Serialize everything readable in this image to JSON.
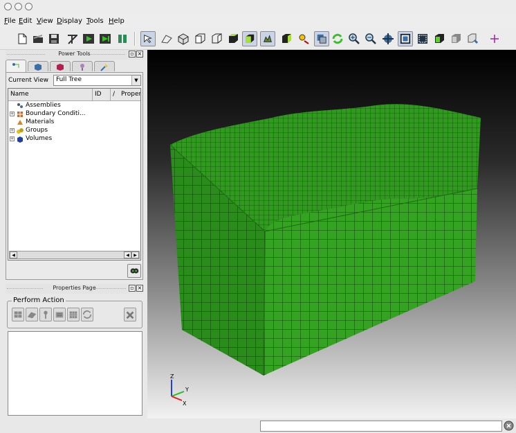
{
  "window": {
    "title": ""
  },
  "menu": {
    "items": [
      {
        "label": "File",
        "underline": "F",
        "rest": "ile"
      },
      {
        "label": "Edit",
        "underline": "E",
        "rest": "dit"
      },
      {
        "label": "View",
        "underline": "V",
        "rest": "iew"
      },
      {
        "label": "Display",
        "underline": "D",
        "rest": "isplay"
      },
      {
        "label": "Tools",
        "underline": "T",
        "rest": "ools"
      },
      {
        "label": "Help",
        "underline": "H",
        "rest": "elp"
      }
    ]
  },
  "toolbar": {
    "icons": [
      "new-file-icon",
      "open-file-icon",
      "save-icon",
      "cut-icon",
      "play-script-icon",
      "record-icon",
      "pause-icon",
      "select-pointer-icon",
      "probe-icon",
      "view-iso-icon",
      "view-front-icon",
      "view-side-icon",
      "view-top-icon",
      "view-bottom-icon",
      "fit-view-icon",
      "perspective-icon",
      "lights-icon",
      "clipping-icon",
      "rotate-icon",
      "zoom-in-icon",
      "zoom-out-icon",
      "pan-icon",
      "wireframe-icon",
      "hidden-line-icon",
      "smooth-shade-icon",
      "transparent-icon",
      "cube-icon",
      "axis-icon"
    ]
  },
  "power_tools": {
    "title": "Power Tools",
    "float_button": "▫",
    "close_button": "×",
    "tabs": [
      "geometry-tab",
      "mesh-tab",
      "model-tab",
      "boundary-tab",
      "analysis-tab"
    ],
    "current_view_label": "Current View",
    "current_view_value": "Full Tree",
    "columns": {
      "name": "Name",
      "id": "ID",
      "sort": "/",
      "property": "Proper"
    },
    "tree": [
      {
        "label": "Assemblies",
        "expandable": false,
        "icon": "assemblies-icon"
      },
      {
        "label": "Boundary Conditi...",
        "expandable": true,
        "icon": "boundary-conditions-icon"
      },
      {
        "label": "Materials",
        "expandable": false,
        "icon": "materials-icon"
      },
      {
        "label": "Groups",
        "expandable": true,
        "icon": "groups-icon"
      },
      {
        "label": "Volumes",
        "expandable": true,
        "icon": "volumes-icon"
      }
    ]
  },
  "properties_page": {
    "title": "Properties Page",
    "float_button": "▫",
    "close_button": "×",
    "perform_action_label": "Perform Action",
    "actions": [
      "mesh-action-icon",
      "surface-action-icon",
      "probe-action-icon",
      "measure-action-icon",
      "grid-action-icon",
      "refresh-action-icon"
    ],
    "cancel_icon": "cancel-action-icon"
  },
  "viewport": {
    "axis_labels": {
      "x": "X",
      "y": "Y",
      "z": "Z"
    },
    "colors": {
      "mesh_fill": "#2f9a1e",
      "mesh_dark": "#1d6a12",
      "grid_line": "#0c2a08",
      "axis_x": "#e02020",
      "axis_y": "#20c020",
      "axis_z": "#2040e0"
    }
  },
  "status": {
    "command_placeholder": ""
  },
  "colors": {
    "chrome": "#ececec",
    "pressed": "#c9d5e6"
  }
}
